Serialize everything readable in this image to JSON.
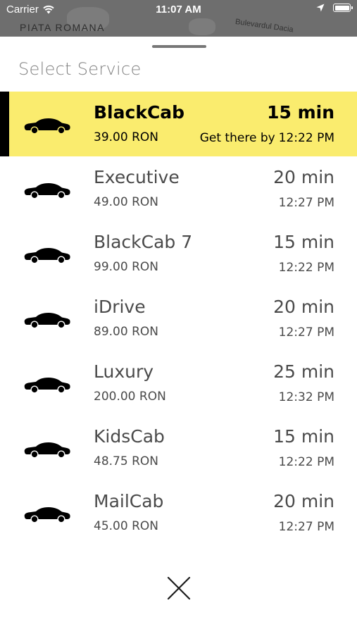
{
  "status_bar": {
    "carrier": "Carrier",
    "time": "11:07 AM"
  },
  "map": {
    "label_left": "PIATA ROMANA",
    "label_right": "Bulevardul Dacia"
  },
  "sheet": {
    "title": "Select Service"
  },
  "services": [
    {
      "name": "BlackCab",
      "price": "39.00 RON",
      "eta": "15 min",
      "arrive_prefix": "Get there by",
      "arrive_time": "12:22 PM",
      "selected": true
    },
    {
      "name": "Executive",
      "price": "49.00 RON",
      "eta": "20 min",
      "arrive_prefix": "",
      "arrive_time": "12:27 PM",
      "selected": false
    },
    {
      "name": "BlackCab 7",
      "price": "99.00 RON",
      "eta": "15 min",
      "arrive_prefix": "",
      "arrive_time": "12:22 PM",
      "selected": false
    },
    {
      "name": "iDrive",
      "price": "89.00 RON",
      "eta": "20 min",
      "arrive_prefix": "",
      "arrive_time": "12:27 PM",
      "selected": false
    },
    {
      "name": "Luxury",
      "price": "200.00 RON",
      "eta": "25 min",
      "arrive_prefix": "",
      "arrive_time": "12:32 PM",
      "selected": false
    },
    {
      "name": "KidsCab",
      "price": "48.75 RON",
      "eta": "15 min",
      "arrive_prefix": "",
      "arrive_time": "12:22 PM",
      "selected": false
    },
    {
      "name": "MailCab",
      "price": "45.00 RON",
      "eta": "20 min",
      "arrive_prefix": "",
      "arrive_time": "12:27 PM",
      "selected": false
    }
  ],
  "icons": {
    "service": "car-icon",
    "close": "close-icon",
    "wifi": "wifi-icon",
    "location": "location-arrow-icon",
    "battery": "battery-icon"
  },
  "colors": {
    "selected_background": "#faec6e",
    "selected_bar": "#000000",
    "text_secondary": "#4a4a4a"
  }
}
